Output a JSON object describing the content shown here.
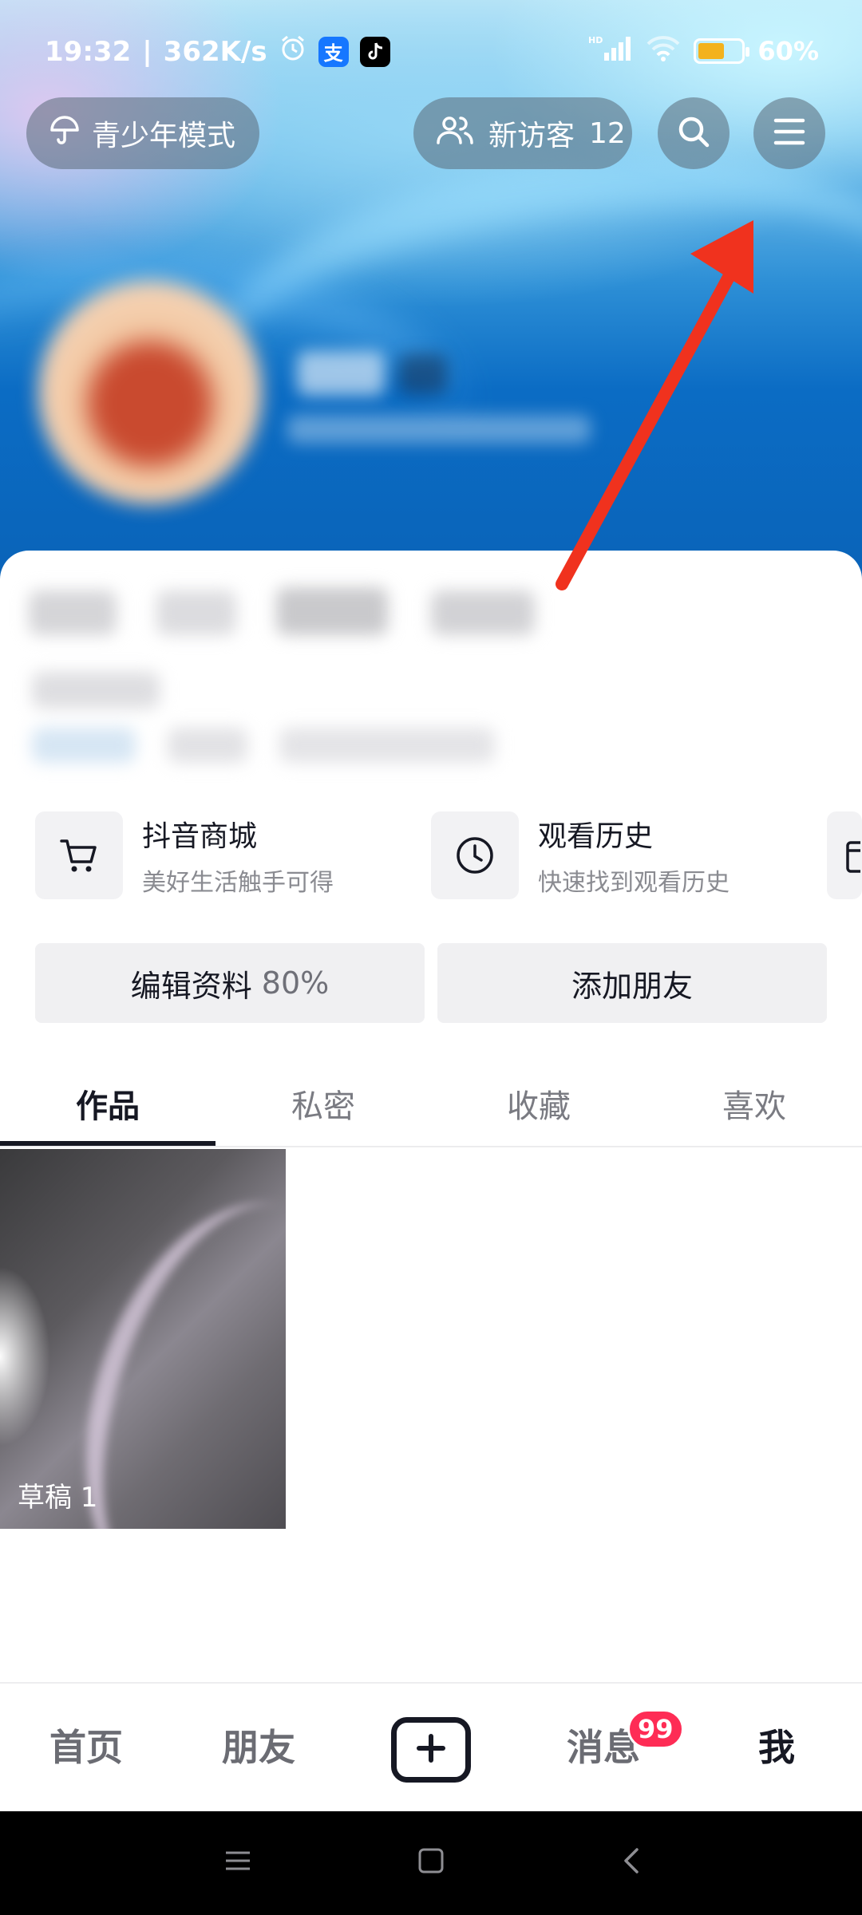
{
  "status_bar": {
    "time": "19:32",
    "net_speed": "362K/s",
    "battery": "60%",
    "battery_level": 0.6,
    "signal_label": "HD"
  },
  "top_bar": {
    "teen_mode_label": "青少年模式",
    "visitors_label": "新访客",
    "visitors_count": "12"
  },
  "entries": [
    {
      "title": "抖音商城",
      "subtitle": "美好生活触手可得",
      "icon": "cart-icon"
    },
    {
      "title": "观看历史",
      "subtitle": "快速找到观看历史",
      "icon": "clock-icon"
    },
    {
      "title": "",
      "subtitle": "",
      "icon": "calendar-icon"
    }
  ],
  "buttons": {
    "edit_profile": "编辑资料",
    "edit_profile_pct": "80%",
    "add_friend": "添加朋友"
  },
  "tabs": [
    "作品",
    "私密",
    "收藏",
    "喜欢"
  ],
  "active_tab": 0,
  "works": {
    "draft_label": "草稿 1"
  },
  "bottom_nav": {
    "home": "首页",
    "friends": "朋友",
    "messages": "消息",
    "messages_badge": "99",
    "me": "我"
  },
  "colors": {
    "accent_red": "#fe2c55",
    "annotation_arrow": "#f0321e",
    "battery_fill": "#f3b21d"
  }
}
